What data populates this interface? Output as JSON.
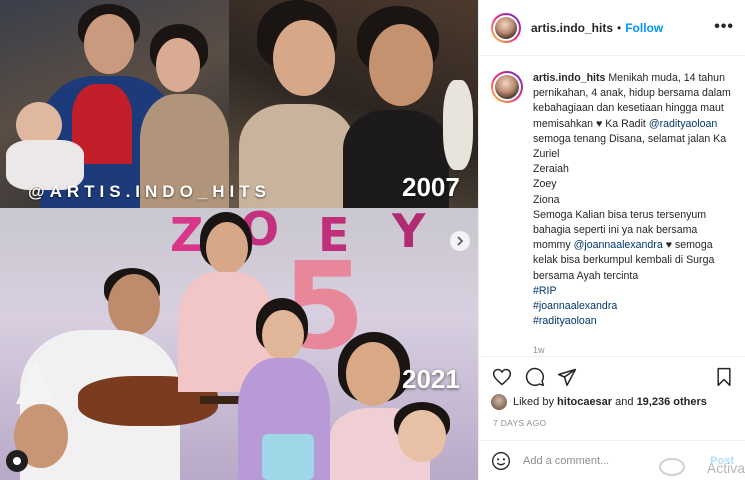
{
  "post": {
    "media": {
      "watermark": "@ARTIS.INDO_HITS",
      "year_top": "2007",
      "year_bottom": "2021",
      "balloon_number": "5"
    },
    "header": {
      "username": "artis.indo_hits",
      "separator": "•",
      "follow_label": "Follow",
      "more_label": "•••"
    },
    "caption": {
      "username": "artis.indo_hits",
      "line1": "Menikah muda, 14 tahun pernikahan, 4 anak, hidup bersama dalam kebahagiaan dan kesetiaan hingga maut memisahkan ♥ Ka Radit",
      "mention1": "@radityaoloan",
      "line2": "semoga tenang Disana, selamat jalan Ka ",
      "names": [
        "Zuriel",
        "Zeraiah",
        "Zoey",
        "Ziona"
      ],
      "line3": "Semoga Kalian bisa terus tersenyum bahagia seperti ini ya nak bersama mommy",
      "mention2": "@joannaalexandra",
      "line4": "♥ semoga kelak bisa berkumpul kembali di Surga bersama Ayah tercinta ",
      "hashtags": [
        "#RIP",
        "#joannaalexandra",
        "#radityaoloan"
      ],
      "time": "1w"
    },
    "likes": {
      "prefix": "Liked by",
      "user": "hitocaesar",
      "middle": "and",
      "count": "19,236 others"
    },
    "date": "7 DAYS AGO",
    "comment_box": {
      "placeholder": "Add a comment...",
      "post_label": "Post",
      "overlay_text": "Activa"
    },
    "icons": {
      "like": "heart-icon",
      "comment": "comment-icon",
      "share": "share-icon",
      "save": "bookmark-icon",
      "emoji": "smile-icon",
      "next": "chevron-right-icon"
    },
    "colors": {
      "accent": "#0095f6",
      "link": "#00376b",
      "muted": "#8e8e8e",
      "border": "#efefef"
    }
  }
}
